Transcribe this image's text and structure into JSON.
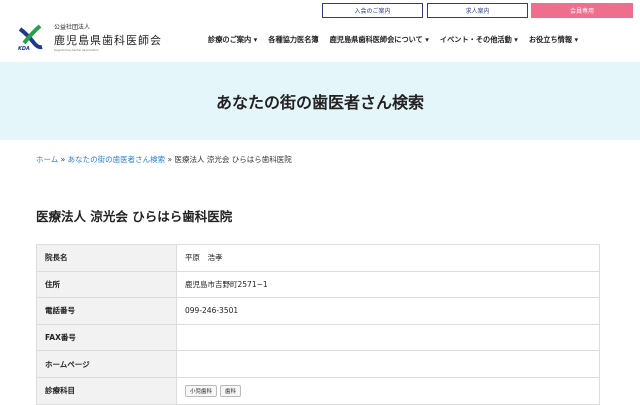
{
  "header": {
    "top_buttons": [
      "入会のご案内",
      "求人案内",
      "会員専用"
    ],
    "logo": {
      "org_type": "公益社団法人",
      "name": "鹿児島県歯科医師会",
      "english": "Kagoshima dental association",
      "mark": "KDA"
    },
    "nav": [
      "診療のご案内 ▾",
      "各種協力医名簿",
      "鹿児島県歯科医師会について ▾",
      "イベント・その他活動 ▾",
      "お役立ち情報 ▾"
    ]
  },
  "page_title": "あなたの街の歯医者さん検索",
  "breadcrumb": {
    "home": "ホーム",
    "sep": " » ",
    "search": "あなたの街の歯医者さん検索",
    "current": "医療法人 涼光会 ひらはら歯科医院"
  },
  "clinic_name": "医療法人 涼光会 ひらはら歯科医院",
  "details": [
    {
      "label": "院長名",
      "value": "平原　浩孝"
    },
    {
      "label": "住所",
      "value": "鹿児島市吉野町2571−1"
    },
    {
      "label": "電話番号",
      "value": "099-246-3501"
    },
    {
      "label": "FAX番号",
      "value": ""
    },
    {
      "label": "ホームページ",
      "value": ""
    },
    {
      "label": "診療科目",
      "tags": [
        "小児歯科",
        "歯科"
      ]
    }
  ],
  "colors": {
    "navy": "#2b3f80",
    "pink": "#ee6e8e",
    "band": "#e5f6fb",
    "link": "#2a7fd0"
  }
}
